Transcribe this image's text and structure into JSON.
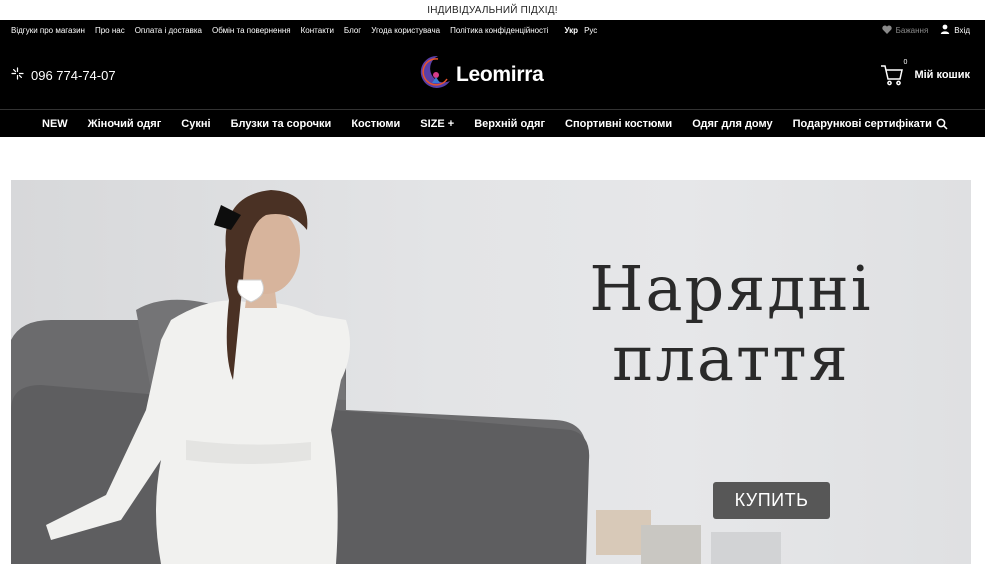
{
  "promo": {
    "text": "ІНДИВІДУАЛЬНИЙ ПІДХІД!"
  },
  "top_links": [
    "Відгуки про магазин",
    "Про нас",
    "Оплата і доставка",
    "Обмін та повернення",
    "Контакти",
    "Блог",
    "Угода користувача",
    "Політика конфіденційності"
  ],
  "lang": {
    "ukr": "Укр",
    "rus": "Рус"
  },
  "user": {
    "wishlist": "Бажання",
    "login": "Вхід"
  },
  "phone": "096 774-74-07",
  "logo": {
    "text": "Leomirra"
  },
  "cart": {
    "count": "0",
    "label": "Мій кошик"
  },
  "nav": [
    "NEW",
    "Жіночий одяг",
    "Сукні",
    "Блузки та сорочки",
    "Костюми",
    "SIZE +",
    "Верхній одяг",
    "Спортивні костюми",
    "Одяг для дому",
    "Подарункові сертифікати"
  ],
  "banner": {
    "headline_line1": "Нарядні",
    "headline_line2": "плаття",
    "button": "КУПИТЬ"
  },
  "colors": {
    "header_bg": "#000000",
    "button_bg": "#575757",
    "banner_bg": "#e3e4e6"
  }
}
